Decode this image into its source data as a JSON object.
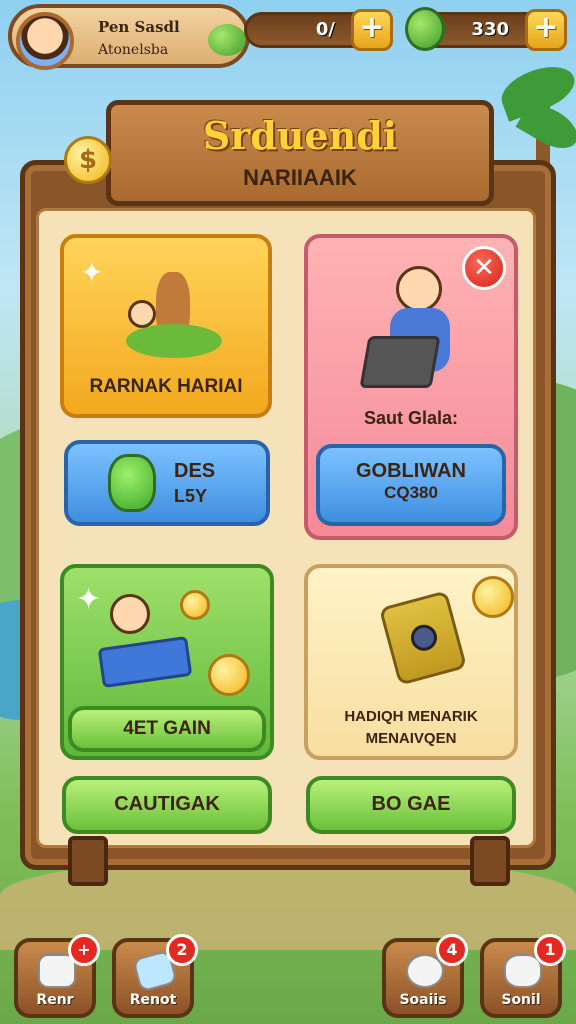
{
  "player": {
    "name": "Pen Sasdl",
    "subtitle": "Atonelsba"
  },
  "resources": [
    {
      "value": "0/",
      "icon": "gem-icon",
      "plus": "+"
    },
    {
      "value": "330",
      "icon": "leaf-icon",
      "plus": "+"
    }
  ],
  "sign": {
    "title": "Srduendi",
    "subtitle": "NARIIAAIK",
    "coin": "$"
  },
  "cards": {
    "daily": {
      "label": "RARNAK HARIAI"
    },
    "pink": {
      "caption": "Saut Glala:",
      "close": "✕"
    },
    "blue_left": {
      "line1": "DES",
      "line2": "L5Y"
    },
    "blue_right": {
      "line1": "GOBLIWAN",
      "line2": "CQ380"
    },
    "green_card": {
      "button": "4ET GAIN"
    },
    "gift": {
      "line1": "HADIQH MENARIK",
      "line2": "MENAIVQEN"
    },
    "btn_left": "CAUTIGAK",
    "btn_right": "BO GAE"
  },
  "nav": [
    {
      "label": "Renr",
      "badge": "+",
      "icon": "map-icon"
    },
    {
      "label": "Renot",
      "badge": "2",
      "icon": "card-icon"
    },
    {
      "label": "Soaiis",
      "badge": "4",
      "icon": "chat-icon"
    },
    {
      "label": "Sonil",
      "badge": "1",
      "icon": "dog-icon"
    }
  ]
}
